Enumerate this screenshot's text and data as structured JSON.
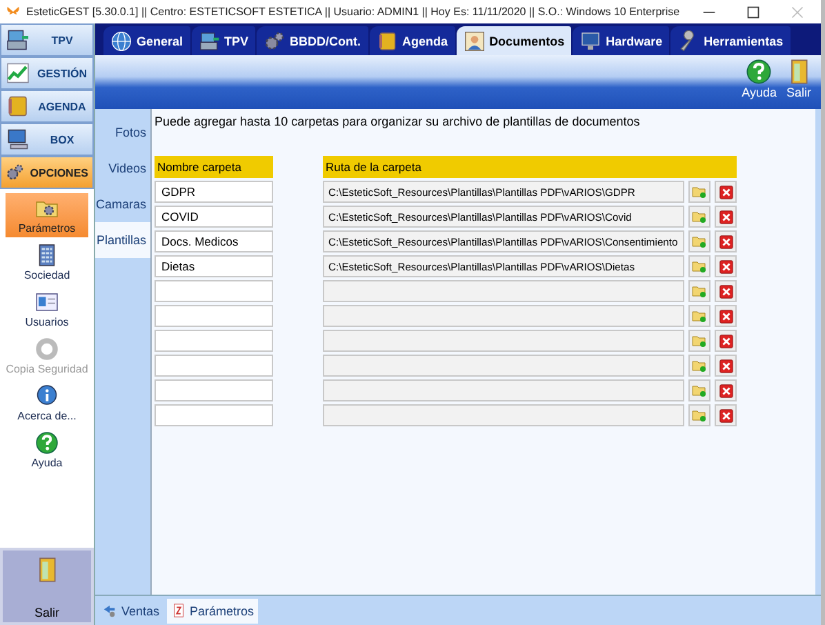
{
  "window": {
    "title": "EsteticGEST [5.30.0.1] || Centro: ESTETICSOFT ESTETICA  || Usuario: ADMIN1 || Hoy Es: 11/11/2020 || S.O.: Windows 10 Enterprise"
  },
  "sidebar": {
    "modules": [
      {
        "label": "TPV",
        "selected": false
      },
      {
        "label": "GESTIÓN",
        "selected": false
      },
      {
        "label": "AGENDA",
        "selected": false
      },
      {
        "label": "BOX",
        "selected": false
      },
      {
        "label": "OPCIONES",
        "selected": true
      }
    ],
    "items": [
      {
        "label": "Parámetros",
        "selected": true,
        "disabled": false
      },
      {
        "label": "Sociedad",
        "selected": false,
        "disabled": false
      },
      {
        "label": "Usuarios",
        "selected": false,
        "disabled": false
      },
      {
        "label": "Copia Seguridad",
        "selected": false,
        "disabled": true
      },
      {
        "label": "Acerca de...",
        "selected": false,
        "disabled": false
      },
      {
        "label": "Ayuda",
        "selected": false,
        "disabled": false
      }
    ],
    "exit_button": {
      "label": "Salir"
    }
  },
  "tabs": [
    {
      "label": "General",
      "selected": false
    },
    {
      "label": "TPV",
      "selected": false
    },
    {
      "label": "BBDD/Cont.",
      "selected": false
    },
    {
      "label": "Agenda",
      "selected": false
    },
    {
      "label": "Documentos",
      "selected": true
    },
    {
      "label": "Hardware",
      "selected": false
    },
    {
      "label": "Herramientas",
      "selected": false
    }
  ],
  "toolbar": {
    "buttons": [
      {
        "label": "Ayuda"
      },
      {
        "label": "Salir"
      }
    ]
  },
  "side_tabs": [
    {
      "label": "Fotos",
      "selected": false
    },
    {
      "label": "Videos",
      "selected": false
    },
    {
      "label": "Camaras",
      "selected": false
    },
    {
      "label": "Plantillas",
      "selected": true
    }
  ],
  "info_text": "Puede agregar hasta 10 carpetas para organizar su archivo de plantillas de documentos",
  "table": {
    "columns": [
      "Nombre carpeta",
      "Ruta de la carpeta"
    ],
    "rows": [
      {
        "name": "GDPR",
        "path": "C:\\EsteticSoft_Resources\\Plantillas\\Plantillas PDF\\vARIOS\\GDPR"
      },
      {
        "name": "COVID",
        "path": "C:\\EsteticSoft_Resources\\Plantillas\\Plantillas PDF\\vARIOS\\Covid"
      },
      {
        "name": "Docs. Medicos",
        "path": "C:\\EsteticSoft_Resources\\Plantillas\\Plantillas PDF\\vARIOS\\Consentimiento"
      },
      {
        "name": "Dietas",
        "path": "C:\\EsteticSoft_Resources\\Plantillas\\Plantillas PDF\\vARIOS\\Dietas"
      },
      {},
      {},
      {},
      {},
      {},
      {}
    ]
  },
  "bottom_tabs": [
    {
      "label": "Ventas",
      "selected": false
    },
    {
      "label": "Parámetros",
      "selected": true
    }
  ]
}
